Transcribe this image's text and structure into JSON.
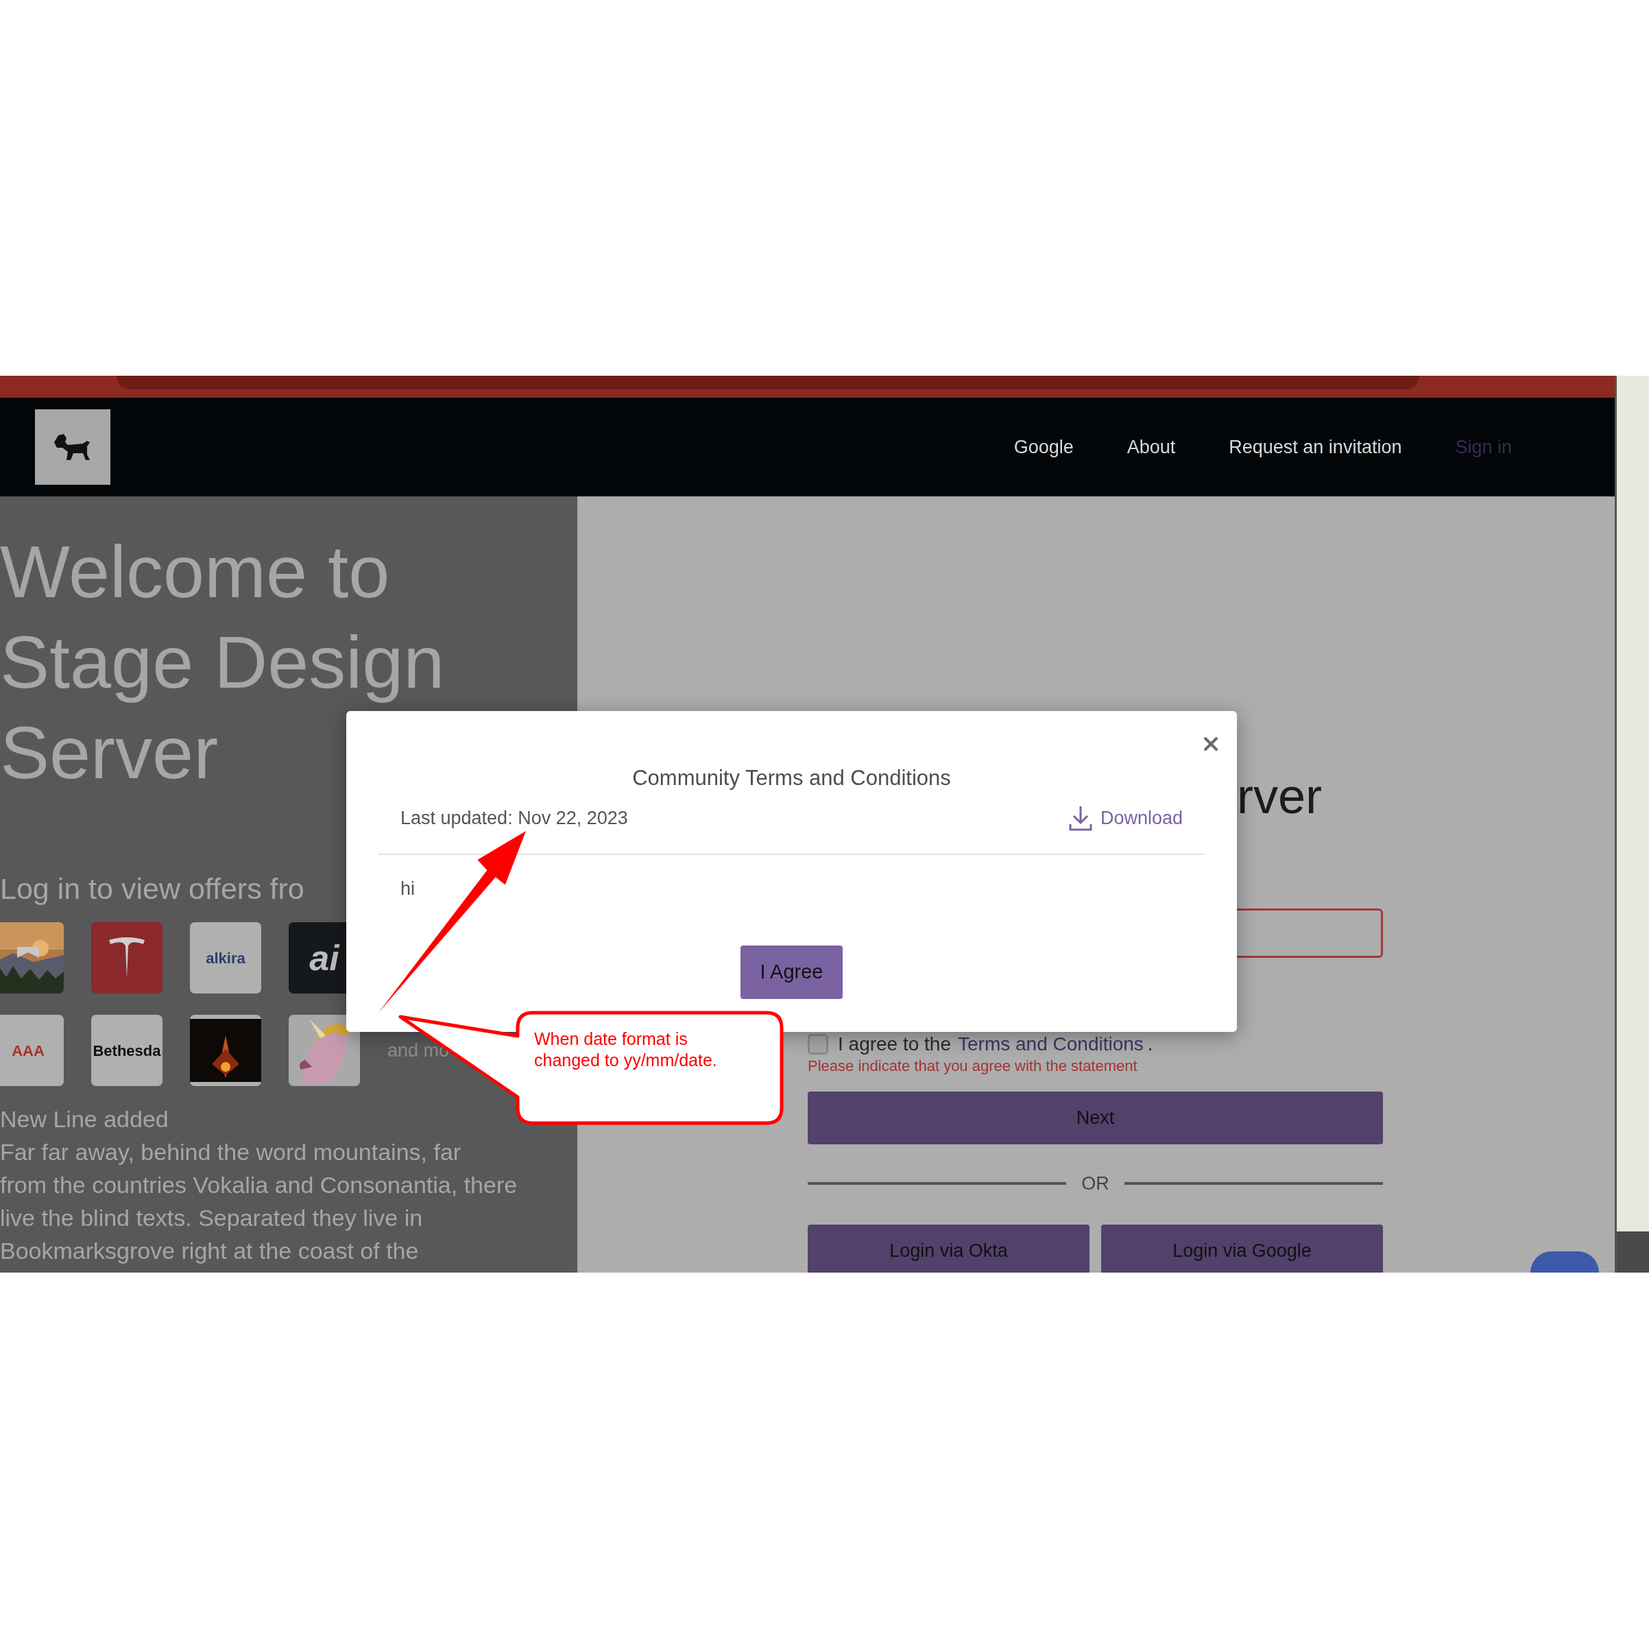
{
  "nav": {
    "links": [
      {
        "label": "Google",
        "selected": false
      },
      {
        "label": "About",
        "selected": false
      },
      {
        "label": "Request an invitation",
        "selected": false
      },
      {
        "label": "Sign in",
        "selected": true
      }
    ]
  },
  "hero": {
    "title": "Welcome to Stage Design Server",
    "subtitle": "Log in to view offers fro",
    "logos": [
      {
        "kind": "picture"
      },
      {
        "kind": "mark"
      },
      {
        "kind": "word",
        "text": "alkira",
        "dark": false,
        "color": "#2b3f6b"
      },
      {
        "kind": "word",
        "text": "ai",
        "dark": true,
        "color": "#bdbdbd"
      },
      {
        "kind": "word",
        "text": "AAA",
        "dark": false,
        "color": "#a8332c"
      },
      {
        "kind": "word",
        "text": "Bethesda",
        "dark": false,
        "color": "#111111"
      },
      {
        "kind": "picture"
      },
      {
        "kind": "picture"
      }
    ],
    "more": "and mo",
    "note": "New Line added",
    "paragraph_lines": [
      "Far far away, behind the word mountains, far",
      "from the countries Vokalia and Consonantia, there",
      "live the blind texts. Separated they live in",
      "Bookmarksgrove right at the coast of the"
    ]
  },
  "form": {
    "heading": "rver",
    "field": {
      "invalid": true
    },
    "agree": {
      "checked": false,
      "text_before": "I agree to the",
      "link": "Terms and Conditions",
      "text_after": "."
    },
    "error": "Please indicate that you agree with the statement",
    "next": "Next",
    "divider": "OR",
    "alt_logins": [
      "Login via Okta",
      "Login via Google"
    ]
  },
  "modal": {
    "title": "Community Terms and Conditions",
    "updated": "Last updated: Nov 22, 2023",
    "download": "Download",
    "body": "hi",
    "agree": "I Agree"
  },
  "annotation": {
    "text": "When date format is changed to yy/mm/date."
  }
}
